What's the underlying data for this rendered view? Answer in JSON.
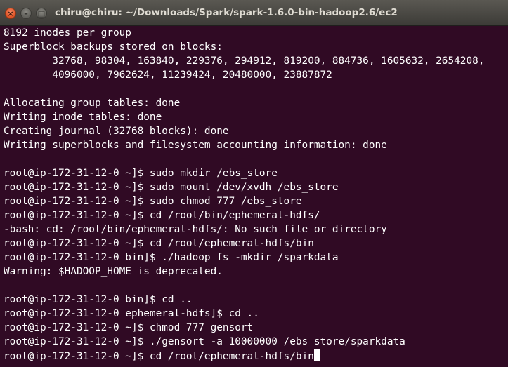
{
  "window": {
    "title": "chiru@chiru: ~/Downloads/Spark/spark-1.6.0-bin-hadoop2.6/ec2",
    "close_glyph": "×",
    "minimize_glyph": "–",
    "maximize_glyph": "□"
  },
  "terminal": {
    "lines": [
      "8192 inodes per group",
      "Superblock backups stored on blocks:",
      "        32768, 98304, 163840, 229376, 294912, 819200, 884736, 1605632, 2654208,",
      "        4096000, 7962624, 11239424, 20480000, 23887872",
      "",
      "Allocating group tables: done",
      "Writing inode tables: done",
      "Creating journal (32768 blocks): done",
      "Writing superblocks and filesystem accounting information: done",
      "",
      "root@ip-172-31-12-0 ~]$ sudo mkdir /ebs_store",
      "root@ip-172-31-12-0 ~]$ sudo mount /dev/xvdh /ebs_store",
      "root@ip-172-31-12-0 ~]$ sudo chmod 777 /ebs_store",
      "root@ip-172-31-12-0 ~]$ cd /root/bin/ephemeral-hdfs/",
      "-bash: cd: /root/bin/ephemeral-hdfs/: No such file or directory",
      "root@ip-172-31-12-0 ~]$ cd /root/ephemeral-hdfs/bin",
      "root@ip-172-31-12-0 bin]$ ./hadoop fs -mkdir /sparkdata",
      "Warning: $HADOOP_HOME is deprecated.",
      "",
      "root@ip-172-31-12-0 bin]$ cd ..",
      "root@ip-172-31-12-0 ephemeral-hdfs]$ cd ..",
      "root@ip-172-31-12-0 ~]$ chmod 777 gensort",
      "root@ip-172-31-12-0 ~]$ ./gensort -a 10000000 /ebs_store/sparkdata"
    ],
    "current_line": "root@ip-172-31-12-0 ~]$ cd /root/ephemeral-hdfs/bin"
  }
}
